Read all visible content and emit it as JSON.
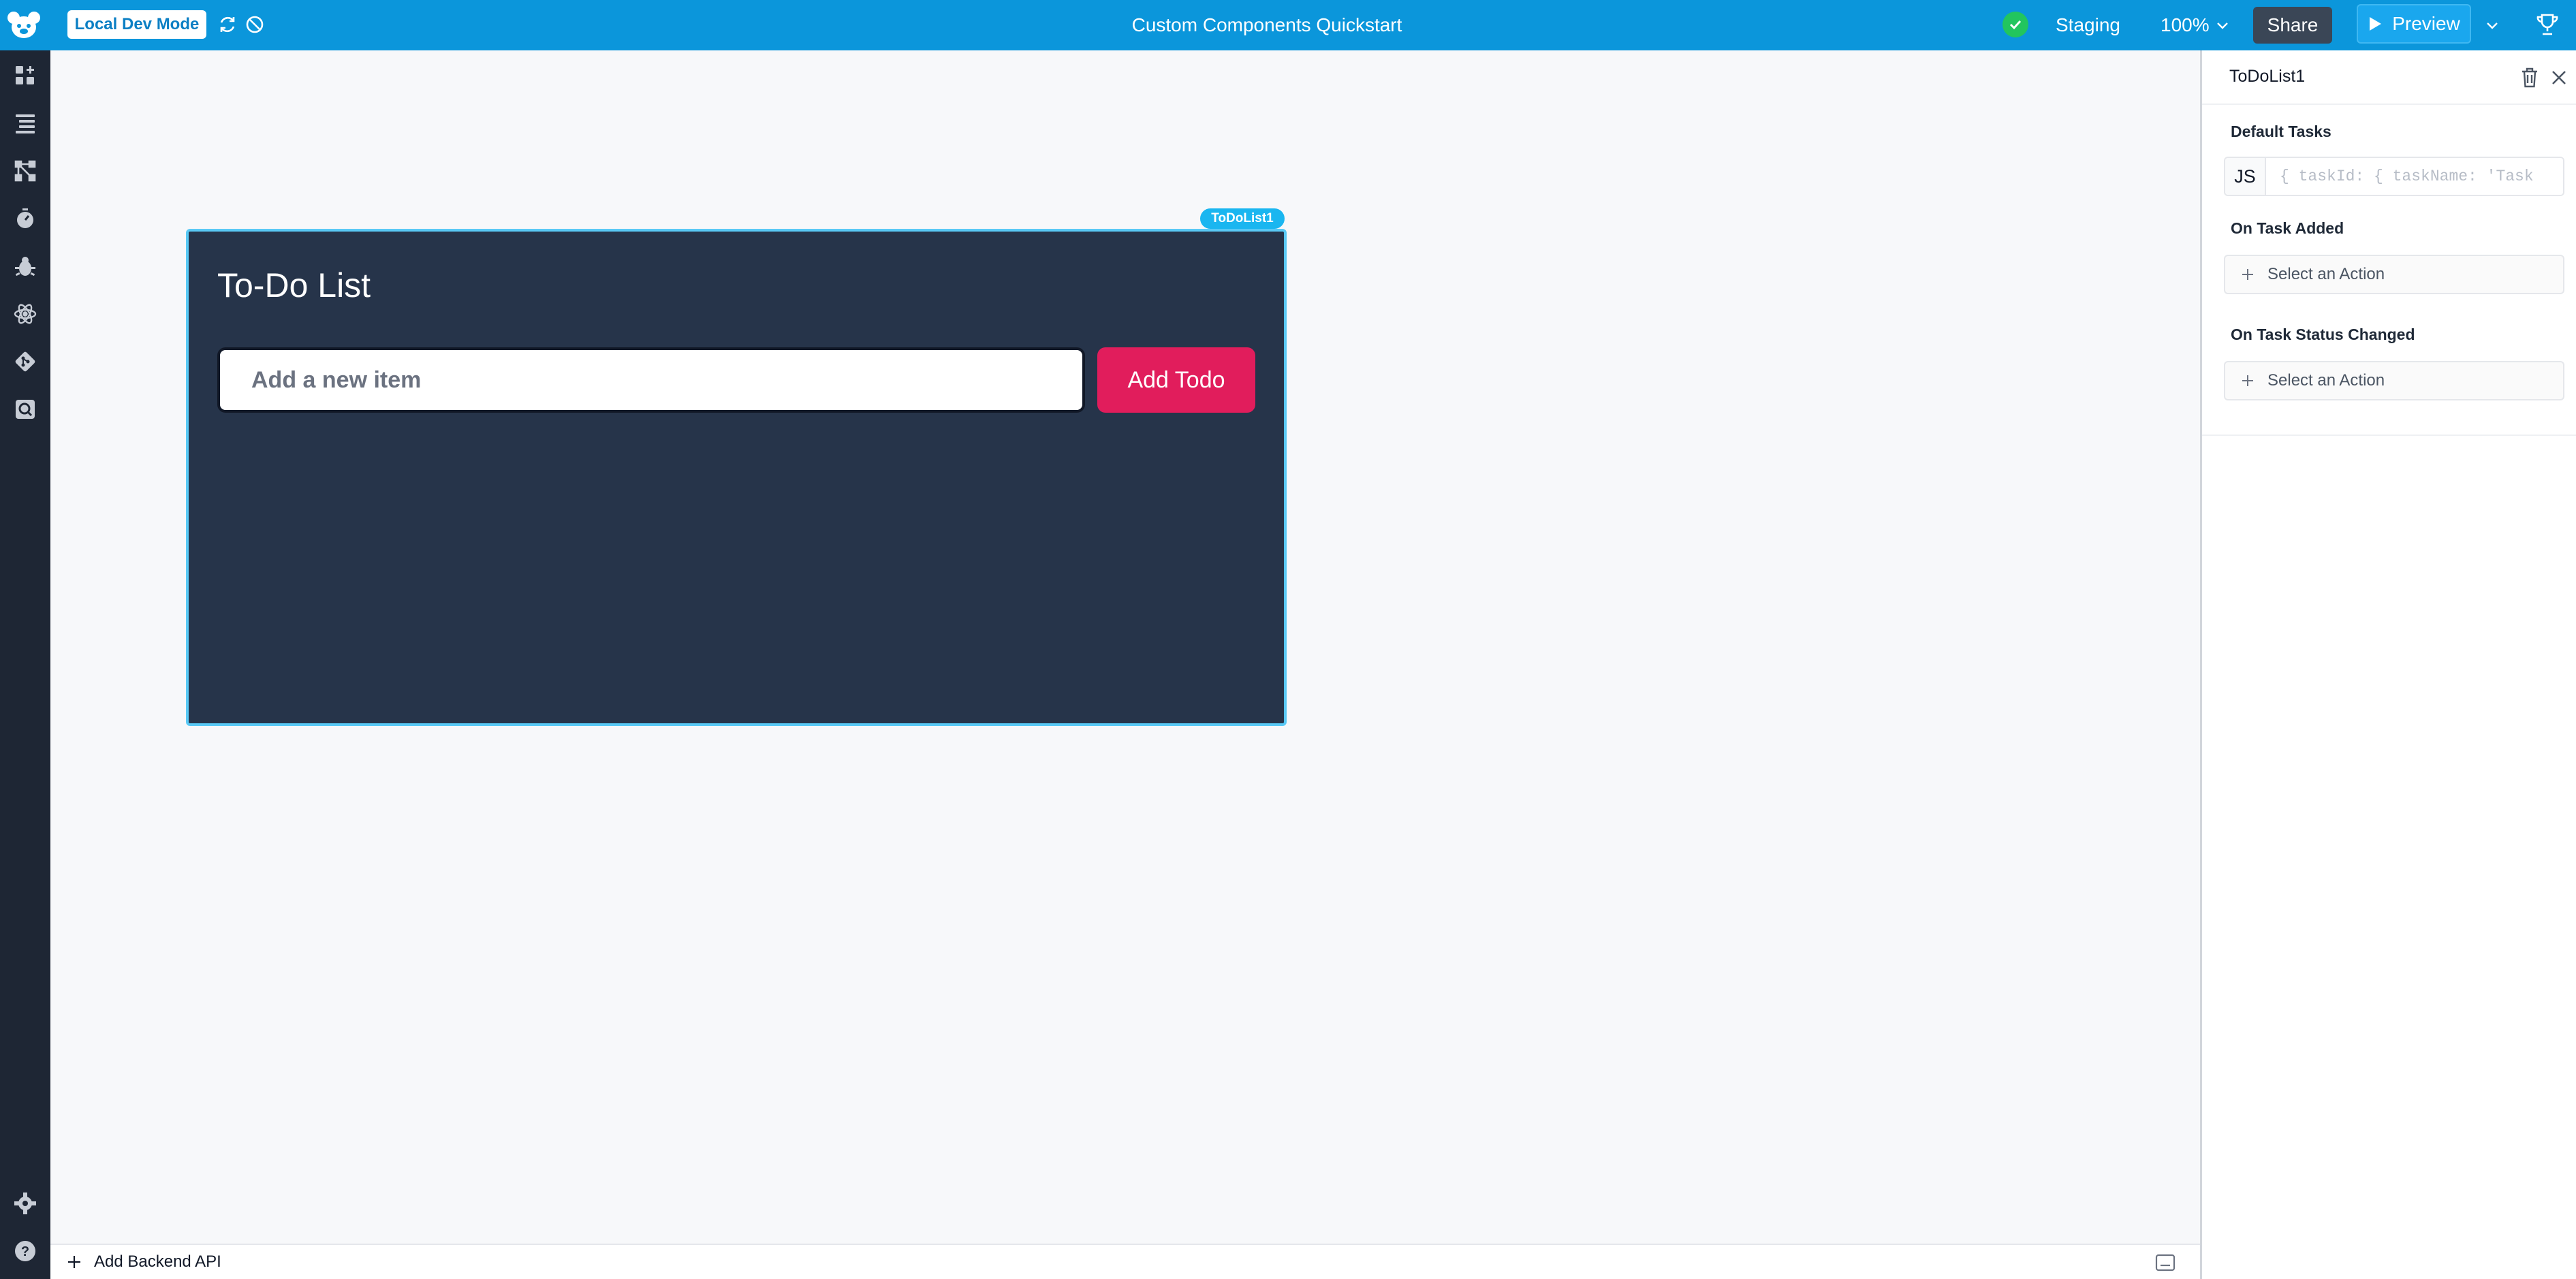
{
  "topbar": {
    "dev_mode_label": "Local Dev Mode",
    "app_title": "Custom Components Quickstart",
    "environment": "Staging",
    "zoom": "100%",
    "share_label": "Share",
    "preview_label": "Preview"
  },
  "canvas": {
    "component_tag": "ToDoList1",
    "todo": {
      "title": "To-Do List",
      "input_placeholder": "Add a new item",
      "add_button_label": "Add Todo"
    }
  },
  "bottombar": {
    "add_api_label": "Add Backend API"
  },
  "inspector": {
    "component_name": "ToDoList1",
    "default_tasks_label": "Default Tasks",
    "js_tag": "JS",
    "default_tasks_placeholder": "{ taskId: { taskName: 'Task",
    "on_task_added_label": "On Task Added",
    "on_task_added_action": "Select an Action",
    "on_task_status_label": "On Task Status Changed",
    "on_task_status_action": "Select an Action"
  },
  "colors": {
    "topbar": "#0b96db",
    "rail": "#1e2634",
    "todo_bg": "#26344a",
    "add_button": "#e11d5c",
    "selection": "#59c9f5"
  }
}
